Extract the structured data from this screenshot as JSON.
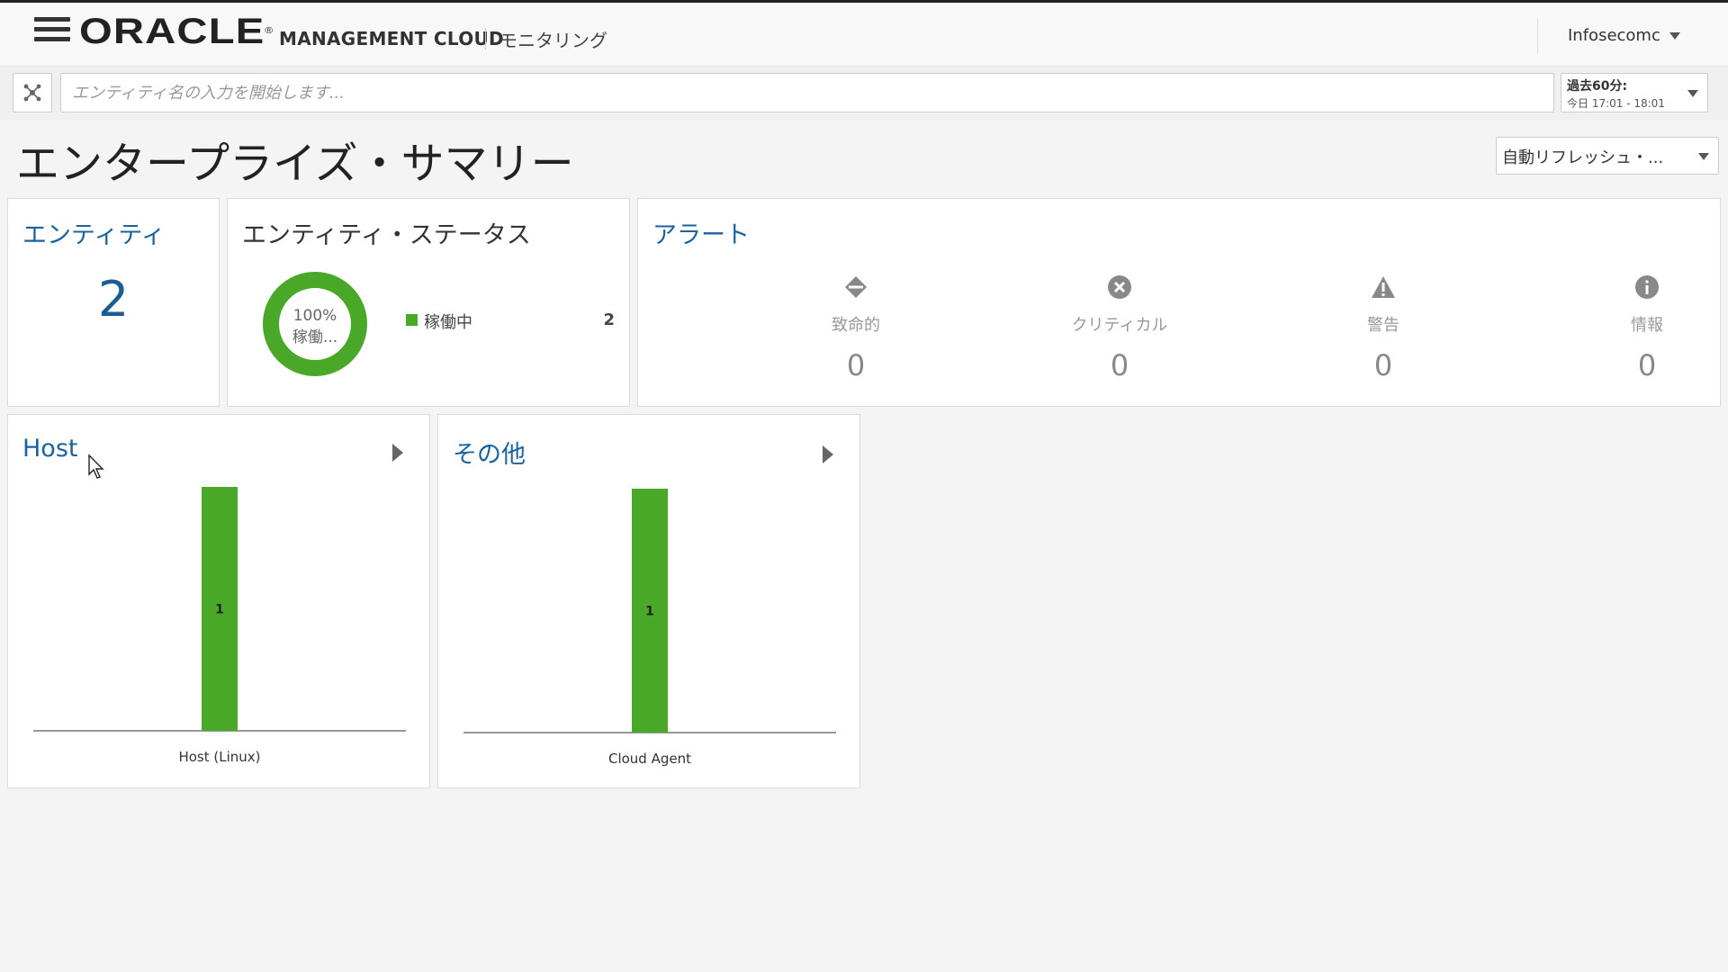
{
  "header": {
    "brand": "ORACLE",
    "product": "MANAGEMENT CLOUD",
    "section": "モニタリング",
    "user": "Infosecomc"
  },
  "search": {
    "placeholder": "エンティティ名の入力を開始します...",
    "time_range_label": "過去60分:",
    "time_range_value": "今日 17:01 - 18:01"
  },
  "page": {
    "title": "エンタープライズ・サマリー",
    "refresh_label": "自動リフレッシュ・..."
  },
  "entities_card": {
    "title": "エンティティ",
    "count": "2"
  },
  "status_card": {
    "title": "エンティティ・ステータス",
    "donut_percent": "100%",
    "donut_label": "稼働...",
    "legend": [
      {
        "label": "稼働中",
        "count": "2",
        "color": "#4aa829"
      }
    ],
    "up_fraction": 1.0
  },
  "alerts_card": {
    "title": "アラート",
    "items": [
      {
        "icon": "fatal-icon",
        "label": "致命的",
        "count": "0"
      },
      {
        "icon": "critical-icon",
        "label": "クリティカル",
        "count": "0"
      },
      {
        "icon": "warning-icon",
        "label": "警告",
        "count": "0"
      },
      {
        "icon": "info-icon",
        "label": "情報",
        "count": "0"
      }
    ]
  },
  "colors": {
    "accent_blue": "#1a62a0",
    "status_green": "#4aa829"
  },
  "chart_data": [
    {
      "type": "bar",
      "title": "Host",
      "categories": [
        "Host (Linux)"
      ],
      "values": [
        1
      ],
      "color": "#4aa829"
    },
    {
      "type": "bar",
      "title": "その他",
      "categories": [
        "Cloud Agent"
      ],
      "values": [
        1
      ],
      "color": "#4aa829"
    }
  ]
}
